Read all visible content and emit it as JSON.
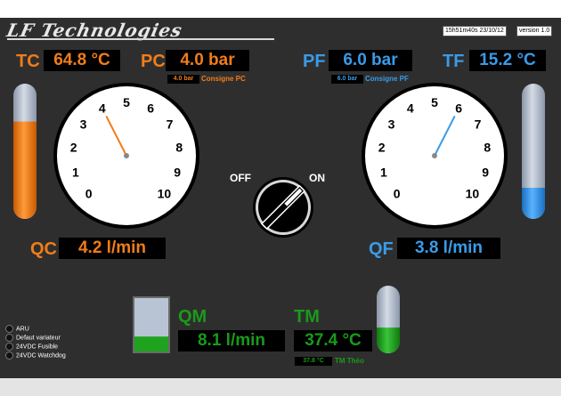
{
  "header": {
    "logo": "LF Technologies",
    "timestamp": "15h51m40s 23/10/12",
    "version": "version 1.0"
  },
  "left": {
    "tc_label": "TC",
    "tc_value": "64.8 °C",
    "tc_level": 0.72,
    "pc_label": "PC",
    "pc_value": "4.0 bar",
    "pc_setpoint_value": "4.0 bar",
    "pc_setpoint_label": "Consigne PC",
    "gauge_value": 4.0,
    "qc_label": "QC",
    "qc_value": "4.2 l/min"
  },
  "right": {
    "pf_label": "PF",
    "pf_value": "6.0 bar",
    "pf_setpoint_value": "6.0 bar",
    "pf_setpoint_label": "Consigne PF",
    "tf_label": "TF",
    "tf_value": "15.2 °C",
    "tf_level": 0.23,
    "gauge_value": 6.0,
    "qf_label": "QF",
    "qf_value": "3.8 l/min"
  },
  "gauge_ticks": [
    "0",
    "1",
    "2",
    "3",
    "4",
    "5",
    "6",
    "7",
    "8",
    "9",
    "10"
  ],
  "switch": {
    "off_label": "OFF",
    "on_label": "ON",
    "state": "ON"
  },
  "bottom": {
    "qm_label": "QM",
    "qm_value": "8.1 l/min",
    "qm_level": 0.28,
    "tm_label": "TM",
    "tm_value": "37.4 °C",
    "tm_level": 0.38,
    "tm_theo_value": "37.8 °C",
    "tm_theo_label": "TM Théo"
  },
  "status": [
    {
      "label": "ARU"
    },
    {
      "label": "Defaut variateur"
    },
    {
      "label": "24VDC Fusible"
    },
    {
      "label": "24VDC Watchdog"
    }
  ],
  "colors": {
    "orange": "#f07d1a",
    "blue": "#3a9be8",
    "green": "#1a9a1a",
    "panel": "#2e2e2e",
    "tank_empty": "#b8c4d4"
  }
}
